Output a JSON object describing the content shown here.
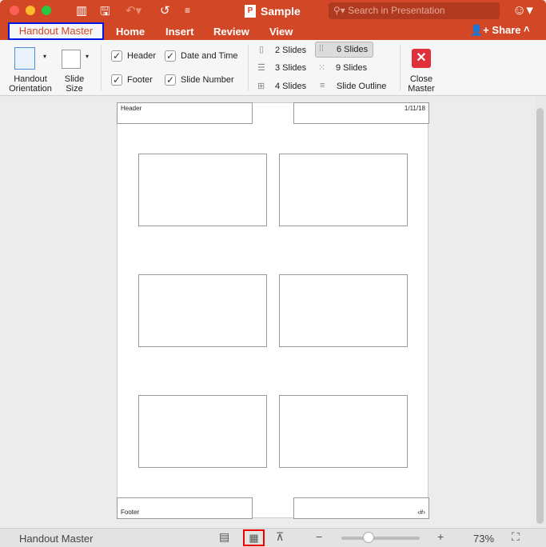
{
  "window": {
    "title": "Sample",
    "search_placeholder": "Search in Presentation"
  },
  "tabs": [
    {
      "label": "Handout Master",
      "active": true
    },
    {
      "label": "Home"
    },
    {
      "label": "Insert"
    },
    {
      "label": "Review"
    },
    {
      "label": "View"
    }
  ],
  "share_label": "Share",
  "ribbon": {
    "handout_orientation": [
      "Handout",
      "Orientation"
    ],
    "slide_size": [
      "Slide",
      "Size"
    ],
    "checkboxes": [
      {
        "label": "Header",
        "checked": true
      },
      {
        "label": "Date and Time",
        "checked": true
      },
      {
        "label": "Footer",
        "checked": true
      },
      {
        "label": "Slide Number",
        "checked": true
      }
    ],
    "layouts": [
      {
        "label": "2 Slides"
      },
      {
        "label": "6 Slides",
        "selected": true
      },
      {
        "label": "3 Slides"
      },
      {
        "label": "9 Slides"
      },
      {
        "label": "4 Slides"
      },
      {
        "label": "Slide Outline"
      }
    ],
    "close_master": [
      "Close",
      "Master"
    ]
  },
  "page": {
    "header": "Header",
    "date": "1/11/18",
    "footer": "Footer",
    "page_number": "‹#›"
  },
  "status": {
    "view_name": "Handout Master",
    "zoom": "73%",
    "zoom_fraction": 0.35
  },
  "colors": {
    "accent": "#d24726",
    "highlight": "#0017e6",
    "close": "#e0303a"
  }
}
